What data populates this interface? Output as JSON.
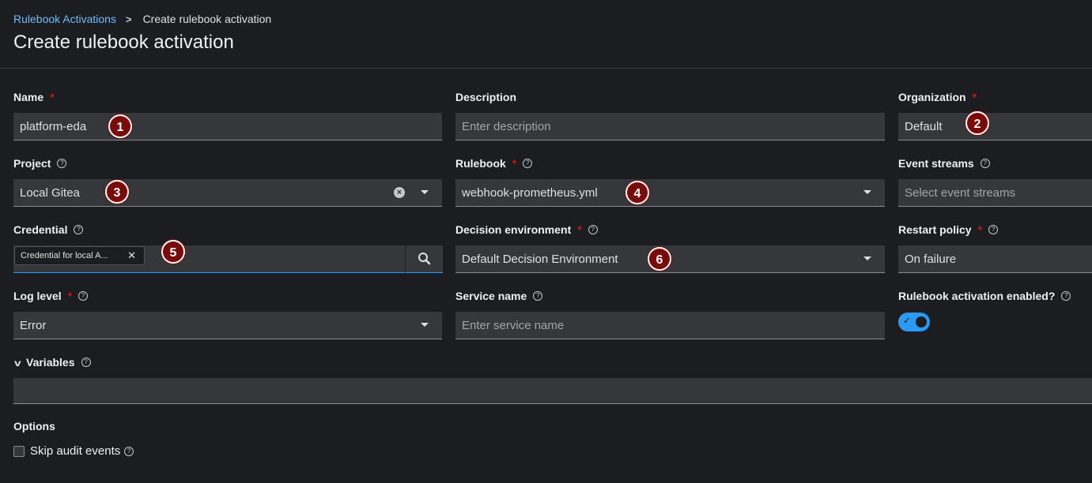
{
  "breadcrumb": {
    "parent": "Rulebook Activations",
    "current": "Create rulebook activation"
  },
  "page_title": "Create rulebook activation",
  "required_marker": "*",
  "fields": {
    "name": {
      "label": "Name",
      "value": "platform-eda"
    },
    "description": {
      "label": "Description",
      "placeholder": "Enter description"
    },
    "organization": {
      "label": "Organization",
      "value": "Default"
    },
    "project": {
      "label": "Project",
      "value": "Local Gitea"
    },
    "rulebook": {
      "label": "Rulebook",
      "value": "webhook-prometheus.yml"
    },
    "event_streams": {
      "label": "Event streams",
      "placeholder": "Select event streams"
    },
    "credential": {
      "label": "Credential",
      "chip": "Credential for local A..."
    },
    "decision_environment": {
      "label": "Decision environment",
      "value": "Default Decision Environment"
    },
    "restart_policy": {
      "label": "Restart policy",
      "value": "On failure"
    },
    "log_level": {
      "label": "Log level",
      "value": "Error"
    },
    "service_name": {
      "label": "Service name",
      "placeholder": "Enter service name"
    },
    "enabled": {
      "label": "Rulebook activation enabled?",
      "value": true
    }
  },
  "variables": {
    "label": "Variables"
  },
  "options": {
    "label": "Options",
    "skip_audit_label": "Skip audit events",
    "skip_audit_checked": false
  },
  "annotations": [
    "1",
    "2",
    "3",
    "4",
    "5",
    "6"
  ],
  "colors": {
    "accent": "#2b9af3",
    "link": "#73bcf7",
    "required": "#c9190b",
    "badge": "#7a0b0b"
  }
}
